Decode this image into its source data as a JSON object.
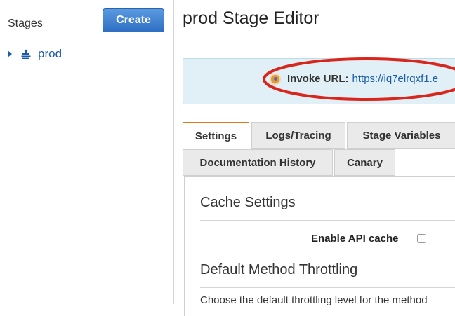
{
  "sidebar": {
    "title": "Stages",
    "create_label": "Create",
    "items": [
      {
        "label": "prod",
        "icon": "stage-icon"
      }
    ]
  },
  "main": {
    "title": "prod Stage Editor",
    "invoke": {
      "label": "Invoke URL:",
      "url": "https://iq7elrqxf1.e"
    },
    "tabs": [
      {
        "label": "Settings",
        "active": true
      },
      {
        "label": "Logs/Tracing",
        "active": false
      },
      {
        "label": "Stage Variables",
        "active": false
      },
      {
        "label": "Documentation History",
        "active": false
      },
      {
        "label": "Canary",
        "active": false
      }
    ],
    "cache_settings": {
      "title": "Cache Settings",
      "enable_label": "Enable API cache",
      "enabled": false
    },
    "throttling": {
      "title": "Default Method Throttling",
      "description": "Choose the default throttling level for the method"
    }
  },
  "colors": {
    "accent": "#1a5ca8",
    "button": "#2f6fc4",
    "active_tab_border": "#e07b1a",
    "annotation": "#d9261c",
    "info_bg": "#e0f0f6"
  }
}
